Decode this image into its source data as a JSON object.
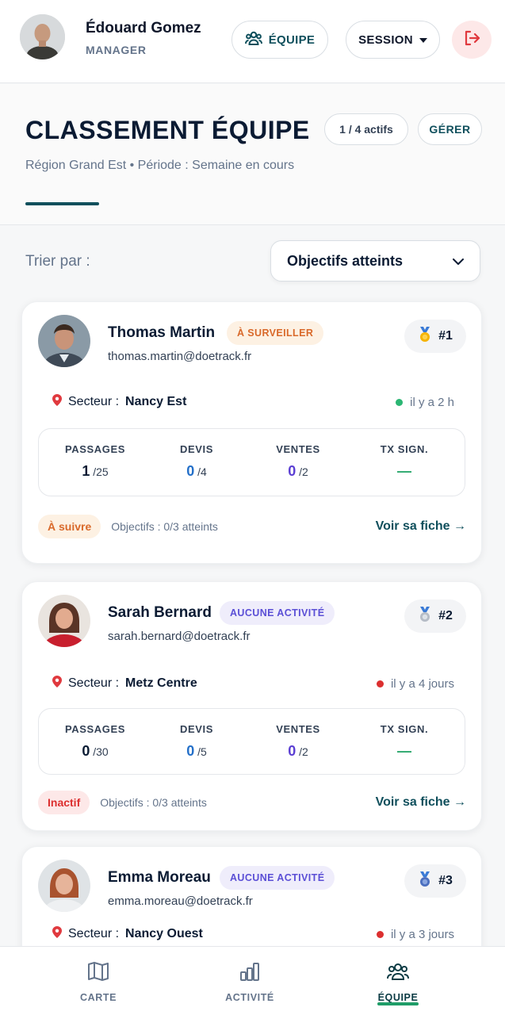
{
  "header": {
    "user_name": "Édouard Gomez",
    "user_role": "MANAGER",
    "team_button": "ÉQUIPE",
    "session_button": "SESSION",
    "logout_icon": "logout-icon"
  },
  "title_section": {
    "title": "CLASSEMENT ÉQUIPE",
    "active_count": "1 / 4 actifs",
    "manage_label": "GÉRER",
    "subtitle": "Région Grand Est • Période : Semaine en cours"
  },
  "sort": {
    "label": "Trier par :",
    "selected": "Objectifs atteints"
  },
  "cards": [
    {
      "name": "Thomas Martin",
      "badge": "À SURVEILLER",
      "email": "thomas.martin@doetrack.fr",
      "rank": "#1",
      "sector_label": "Secteur :",
      "sector": "Nancy Est",
      "last_seen": "il y a 2 h",
      "last_seen_color": "#2bb673",
      "stats": [
        {
          "label": "PASSAGES",
          "value": "1",
          "total": "/25"
        },
        {
          "label": "DEVIS",
          "value": "0",
          "total": "/4"
        },
        {
          "label": "VENTES",
          "value": "0",
          "total": "/2"
        },
        {
          "label": "TX SIGN.",
          "value": "—",
          "total": ""
        }
      ],
      "status": "À suivre",
      "goals": "Objectifs : 0/3 atteints",
      "link": "Voir sa fiche →"
    },
    {
      "name": "Sarah Bernard",
      "badge": "AUCUNE ACTIVITÉ",
      "email": "sarah.bernard@doetrack.fr",
      "rank": "#2",
      "sector_label": "Secteur :",
      "sector": "Metz Centre",
      "last_seen": "il y a 4 jours",
      "last_seen_color": "#dc2f2f",
      "stats": [
        {
          "label": "PASSAGES",
          "value": "0",
          "total": "/30"
        },
        {
          "label": "DEVIS",
          "value": "0",
          "total": "/5"
        },
        {
          "label": "VENTES",
          "value": "0",
          "total": "/2"
        },
        {
          "label": "TX SIGN.",
          "value": "—",
          "total": ""
        }
      ],
      "status": "Inactif",
      "goals": "Objectifs : 0/3 atteints",
      "link": "Voir sa fiche →"
    },
    {
      "name": "Emma Moreau",
      "badge": "AUCUNE ACTIVITÉ",
      "email": "emma.moreau@doetrack.fr",
      "rank": "#3",
      "sector_label": "Secteur :",
      "sector": "Nancy Ouest",
      "last_seen": "il y a 3 jours",
      "last_seen_color": "#dc2f2f"
    }
  ],
  "nav": [
    {
      "label": "CARTE",
      "icon": "map-icon"
    },
    {
      "label": "ACTIVITÉ",
      "icon": "bar-chart-icon"
    },
    {
      "label": "ÉQUIPE",
      "icon": "team-icon"
    }
  ],
  "colors": {
    "accent": "#0f4f5c",
    "active_indicator": "#1f9d68"
  }
}
